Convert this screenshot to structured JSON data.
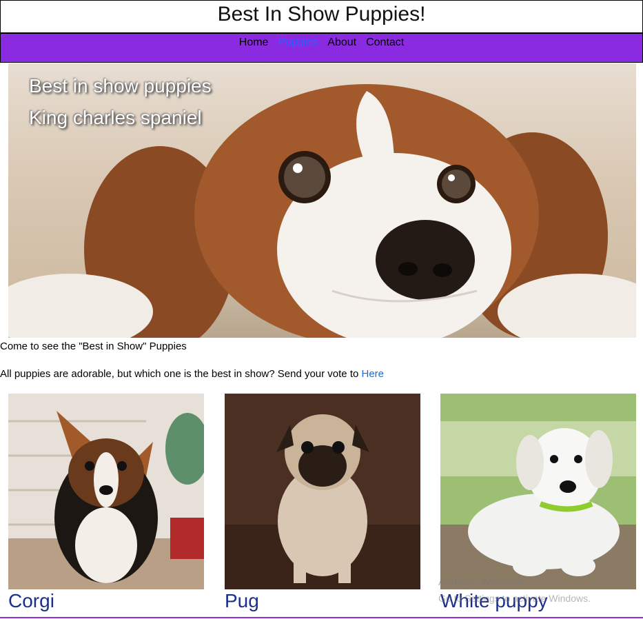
{
  "header": {
    "title": "Best In Show Puppies!"
  },
  "nav": {
    "items": [
      {
        "label": "Home"
      },
      {
        "label": "Puppies"
      },
      {
        "label": "About"
      },
      {
        "label": "Contact"
      }
    ],
    "active": "Puppies",
    "background": "#8a2be2",
    "active_color": "#1e64ff"
  },
  "hero": {
    "line1": "Best in show puppies",
    "line2": "King charles spaniel"
  },
  "intro": {
    "line1": "Come to see the \"Best in Show\" Puppies",
    "line2_text": "All puppies are adorable, but which one is the best in show? Send your vote to ",
    "line2_link": "Here"
  },
  "cards": [
    {
      "name": "Corgi",
      "image": "corgi-puppy"
    },
    {
      "name": "Pug",
      "image": "pug-puppy"
    },
    {
      "name": "White puppy",
      "image": "white-puppy"
    }
  ],
  "watermark": {
    "line1": "Activate Windows",
    "line2": "Go to Settings to activate Windows."
  }
}
